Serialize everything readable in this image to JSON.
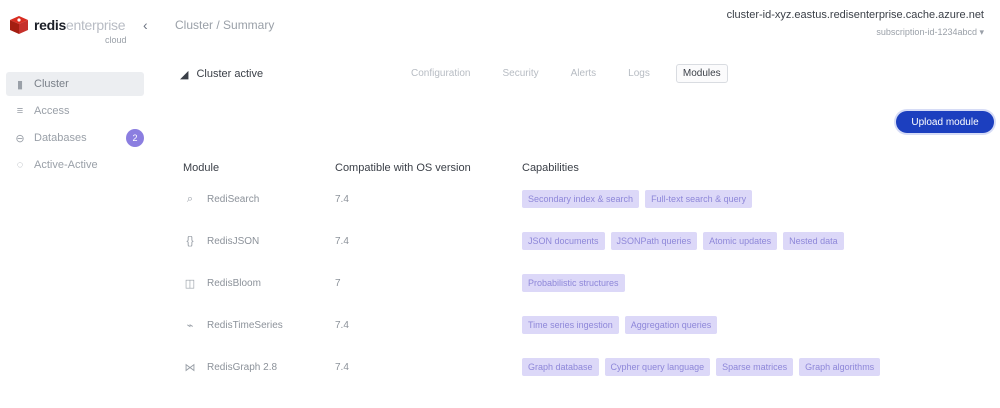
{
  "brand": {
    "name_bold": "redis",
    "name_light": "enterprise",
    "sub": "cloud"
  },
  "breadcrumb": "Cluster / Summary",
  "user": {
    "email": "cluster-id-xyz.eastus.redisenterprise.cache.azure.net",
    "sub": "subscription-id-1234abcd ▾"
  },
  "sidebar": {
    "items": [
      {
        "label": "Cluster",
        "icon": "▮"
      },
      {
        "label": "Access",
        "icon": "≡"
      },
      {
        "label": "Databases",
        "icon": "⊖",
        "badge": "2"
      },
      {
        "label": "Active-Active",
        "icon": "◌"
      }
    ]
  },
  "toolbar": {
    "status": "Cluster active",
    "filters": [
      "Configuration",
      "Security",
      "Alerts",
      "Logs",
      "Modules"
    ],
    "selected_filter": 4
  },
  "actions": {
    "primary": "Upload module"
  },
  "table": {
    "headers": [
      "Module",
      "Compatible with OS version",
      "Capabilities"
    ],
    "rows": [
      {
        "module": "RediSearch",
        "icon": "⌕",
        "compat": "7.4",
        "caps": [
          "Secondary index & search",
          "Full-text search & query"
        ]
      },
      {
        "module": "RedisJSON",
        "icon": "{}",
        "compat": "7.4",
        "caps": [
          "JSON documents",
          "JSONPath queries",
          "Atomic updates",
          "Nested data"
        ]
      },
      {
        "module": "RedisBloom",
        "icon": "◫",
        "compat": "7",
        "caps": [
          "Probabilistic structures"
        ]
      },
      {
        "module": "RedisTimeSeries",
        "icon": "⌁",
        "compat": "7.4",
        "caps": [
          "Time series ingestion",
          "Aggregation queries"
        ]
      },
      {
        "module": "RedisGraph 2.8",
        "icon": "⋈",
        "compat": "7.4",
        "caps": [
          "Graph database",
          "Cypher query language",
          "Sparse matrices",
          "Graph algorithms"
        ]
      }
    ]
  },
  "colors": {
    "primary": "#1c3fbf",
    "chip_bg": "#dcd8f8",
    "chip_text": "#8e87d9",
    "badge": "#8b7ee0"
  }
}
